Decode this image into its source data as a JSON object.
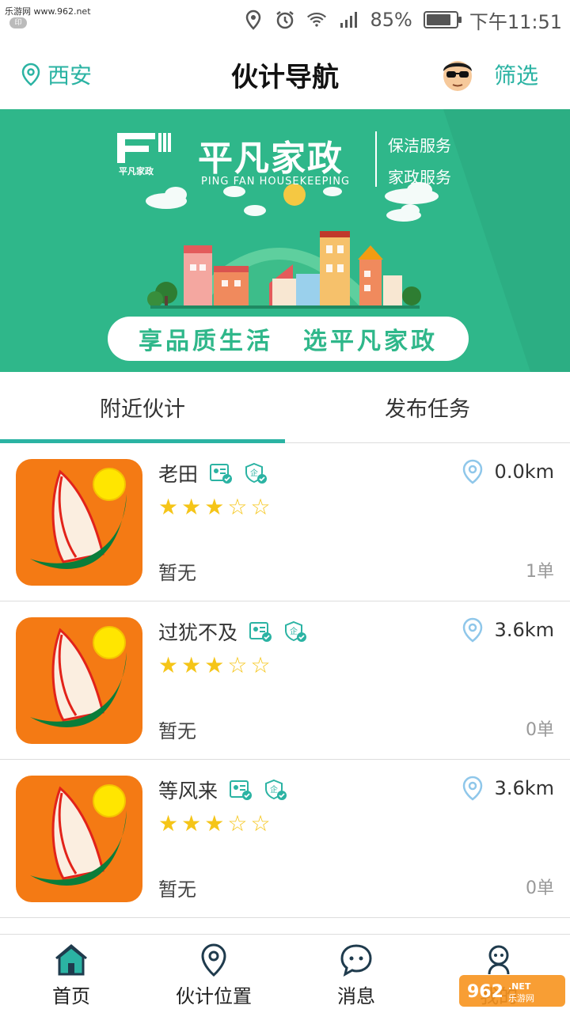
{
  "statusbar": {
    "watermark": "乐游网 www.962.net",
    "watermark_icon": "印",
    "battery_text": "85%",
    "battery_level": 0.85,
    "time": "下午11:51",
    "icons": [
      "location-icon",
      "alarm-icon",
      "wifi-icon",
      "signal-icon",
      "battery-icon"
    ]
  },
  "header": {
    "location": "西安",
    "title": "伙计导航",
    "filter": "筛选"
  },
  "banner": {
    "logo_name": "平凡家政",
    "brand": "平凡家政",
    "brand_en": "PING FAN HOUSEKEEPING",
    "service1": "保洁服务",
    "service2": "家政服务",
    "slogan_left": "享品质生活",
    "slogan_right": "选平凡家政"
  },
  "tabs": [
    {
      "label": "附近伙计",
      "active": true
    },
    {
      "label": "发布任务",
      "active": false
    }
  ],
  "list": [
    {
      "name": "老田",
      "rating": 3,
      "max_rating": 5,
      "distance": "0.0km",
      "desc": "暂无",
      "orders": "1单"
    },
    {
      "name": "过犹不及",
      "rating": 3,
      "max_rating": 5,
      "distance": "3.6km",
      "desc": "暂无",
      "orders": "0单"
    },
    {
      "name": "等风来",
      "rating": 3,
      "max_rating": 5,
      "distance": "3.6km",
      "desc": "暂无",
      "orders": "0单"
    }
  ],
  "bottomnav": [
    {
      "label": "首页",
      "icon": "home-icon",
      "active": true
    },
    {
      "label": "伙计位置",
      "icon": "location-pin-icon",
      "active": false
    },
    {
      "label": "消息",
      "icon": "chat-bubble-icon",
      "active": false
    },
    {
      "label": "我的",
      "icon": "person-icon",
      "active": false
    }
  ],
  "colors": {
    "accent": "#2bb3a3",
    "banner_green": "#2fb78a",
    "app_icon_orange": "#f47a14",
    "star": "#f5c518"
  }
}
